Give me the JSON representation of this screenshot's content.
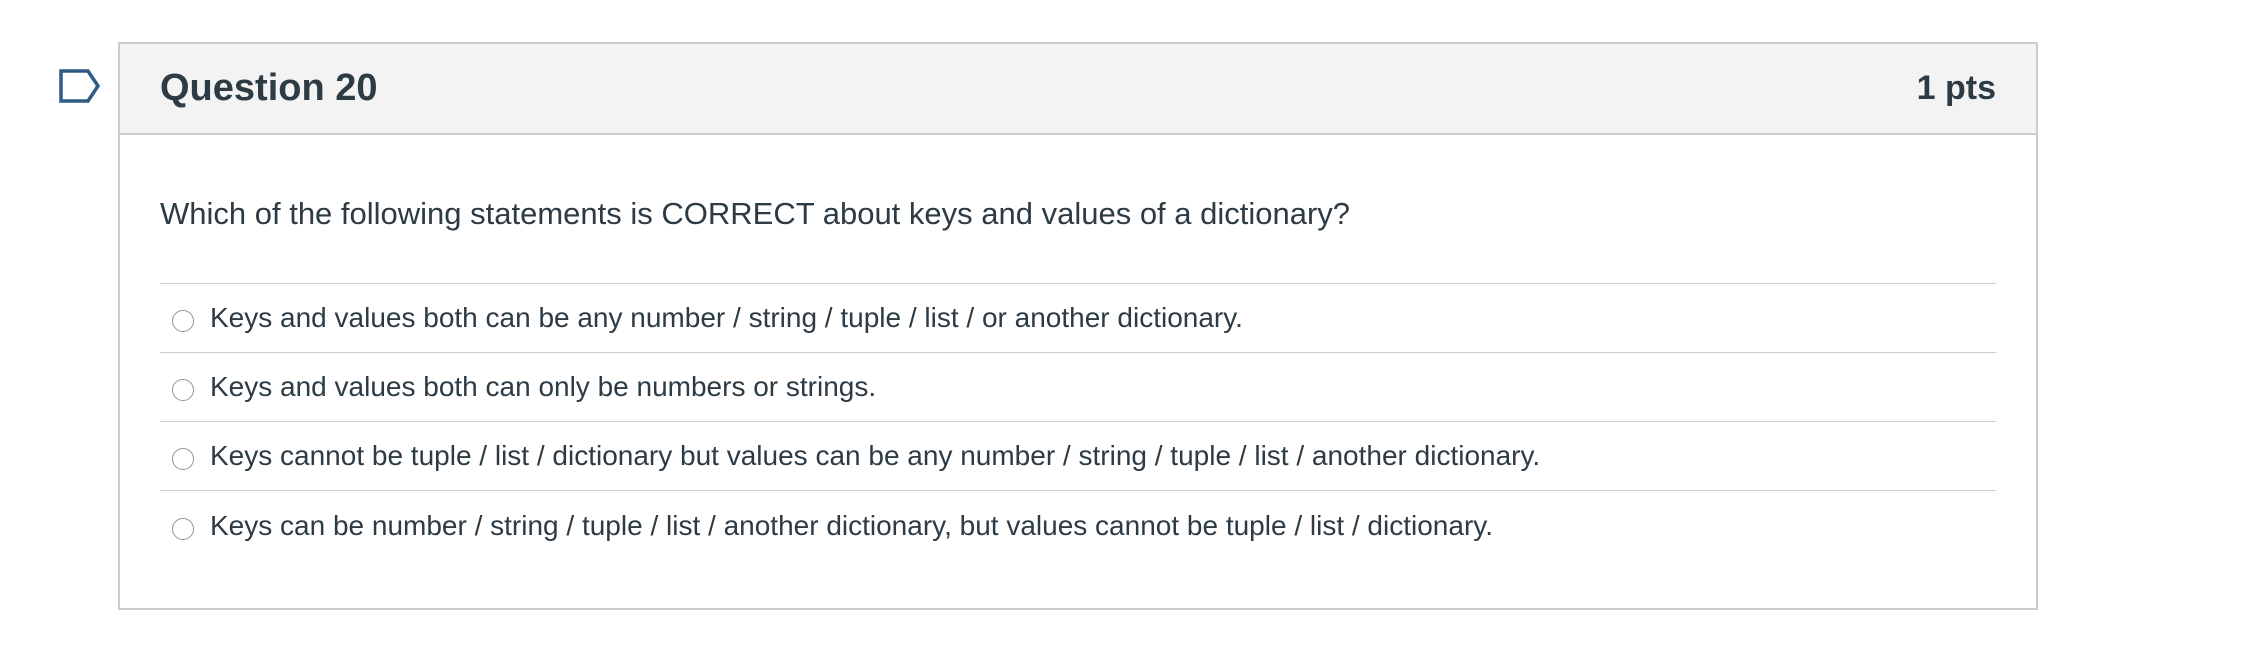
{
  "question": {
    "title": "Question 20",
    "points": "1 pts",
    "text": "Which of the following statements is CORRECT about keys and values of a dictionary?",
    "answers": [
      {
        "label": "Keys and values both can be any number / string / tuple / list / or another dictionary.",
        "selected": false
      },
      {
        "label": "Keys and values both can only be numbers or strings.",
        "selected": false
      },
      {
        "label": "Keys cannot be tuple / list / dictionary but values can be any number / string / tuple / list / another dictionary.",
        "selected": false
      },
      {
        "label": "Keys can be number / string / tuple / list / another dictionary, but values cannot be tuple / list / dictionary.",
        "selected": false
      }
    ]
  },
  "flag": {
    "icon": "bookmark-flag-icon",
    "color": "#2d3b45"
  }
}
